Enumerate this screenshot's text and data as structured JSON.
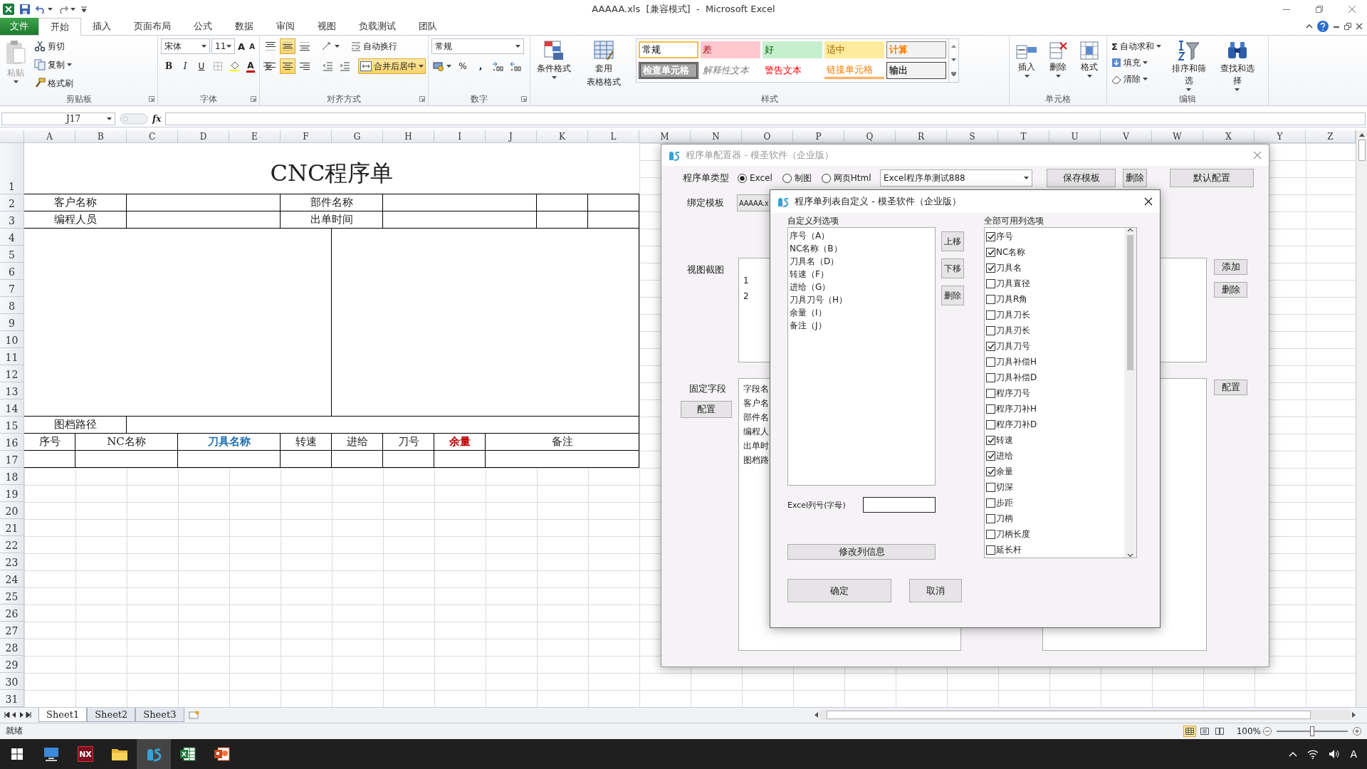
{
  "window": {
    "title": "AAAAA.xls  [兼容模式]  -  Microsoft Excel"
  },
  "ribbon_tabs": [
    {
      "label": "文件",
      "kind": "file",
      "selected": false
    },
    {
      "label": "开始",
      "kind": "tab",
      "selected": true
    },
    {
      "label": "插入",
      "kind": "tab",
      "selected": false
    },
    {
      "label": "页面布局",
      "kind": "tab",
      "selected": false
    },
    {
      "label": "公式",
      "kind": "tab",
      "selected": false
    },
    {
      "label": "数据",
      "kind": "tab",
      "selected": false
    },
    {
      "label": "审阅",
      "kind": "tab",
      "selected": false
    },
    {
      "label": "视图",
      "kind": "tab",
      "selected": false
    },
    {
      "label": "负载测试",
      "kind": "tab",
      "selected": false
    },
    {
      "label": "团队",
      "kind": "tab",
      "selected": false
    }
  ],
  "clipboard": {
    "label": "剪贴板",
    "paste": {
      "label": "粘贴",
      "disabled": true
    },
    "actions": [
      {
        "kind": "cut",
        "label": "剪切"
      },
      {
        "kind": "copy",
        "label": "复制"
      },
      {
        "kind": "painter",
        "label": "格式刷"
      }
    ]
  },
  "font": {
    "label": "字体",
    "family": "宋体",
    "size": "11",
    "grow": "A",
    "shrink": "A",
    "bold": "B",
    "italic": "I",
    "underline": "U",
    "color_letter": "A"
  },
  "alignment": {
    "label": "对齐方式",
    "vertical": [
      {
        "kind": "top",
        "selected": false
      },
      {
        "kind": "middle",
        "selected": true
      },
      {
        "kind": "bottom",
        "selected": false
      }
    ],
    "horizontal": [
      {
        "kind": "left",
        "selected": false
      },
      {
        "kind": "center",
        "selected": true
      },
      {
        "kind": "right",
        "selected": false
      }
    ],
    "wrap": "自动换行",
    "merge": {
      "label": "合并后居中",
      "selected": true
    }
  },
  "number": {
    "label": "数字",
    "format": "常规",
    "percent": "%",
    "comma": ","
  },
  "styles": {
    "label": "样式",
    "conditional": "条件格式",
    "table_format": [
      "套用",
      "表格格式"
    ],
    "gallery": [
      {
        "label": "常规",
        "kind": "normal"
      },
      {
        "label": "差",
        "kind": "bad"
      },
      {
        "label": "好",
        "kind": "good"
      },
      {
        "label": "适中",
        "kind": "neutral"
      },
      {
        "label": "计算",
        "kind": "calculation"
      },
      {
        "label": "检查单元格",
        "kind": "check"
      },
      {
        "label": "解释性文本",
        "kind": "explanatory"
      },
      {
        "label": "警告文本",
        "kind": "warning"
      },
      {
        "label": "链接单元格",
        "kind": "linked"
      },
      {
        "label": "输出",
        "kind": "output"
      }
    ]
  },
  "cells": {
    "label": "单元格",
    "commands": [
      {
        "kind": "insert",
        "label": "插入"
      },
      {
        "kind": "delete",
        "label": "删除"
      },
      {
        "kind": "format",
        "label": "格式"
      }
    ]
  },
  "editing": {
    "label": "编辑",
    "sum_sign": "Σ",
    "small": [
      {
        "kind": "sum",
        "label": "自动求和"
      },
      {
        "kind": "fill",
        "label": "填充"
      },
      {
        "kind": "clear",
        "label": "清除"
      }
    ],
    "large": [
      {
        "kind": "sort",
        "label": "排序和筛选"
      },
      {
        "kind": "find",
        "label": "查找和选择"
      }
    ]
  },
  "formula_bar": {
    "name_box": "J17",
    "fx": "fx"
  },
  "sheet": {
    "columns": [
      "A",
      "B",
      "C",
      "D",
      "E",
      "F",
      "G",
      "H",
      "I",
      "J",
      "K",
      "L",
      "M",
      "N",
      "O",
      "P",
      "Q",
      "R",
      "S",
      "T",
      "U",
      "V",
      "W",
      "X",
      "Y",
      "Z"
    ],
    "rows": [
      "1",
      "2",
      "3",
      "4",
      "5",
      "6",
      "7",
      "8",
      "9",
      "10",
      "11",
      "12",
      "13",
      "14",
      "15",
      "16",
      "17",
      "18",
      "19",
      "20",
      "21",
      "22",
      "23",
      "24",
      "25",
      "26",
      "27",
      "28",
      "29",
      "30",
      "31"
    ],
    "cells": [
      {
        "kind": "title",
        "text": "CNC程序单"
      },
      {
        "kind": "label",
        "text": "客户名称"
      },
      {
        "kind": "blank"
      },
      {
        "kind": "label",
        "text": "部件名称"
      },
      {
        "kind": "blank"
      },
      {
        "kind": "blank"
      },
      {
        "kind": "blank"
      },
      {
        "kind": "label",
        "text": "编程人员"
      },
      {
        "kind": "blank"
      },
      {
        "kind": "label",
        "text": "出单时间"
      },
      {
        "kind": "blank"
      },
      {
        "kind": "blank"
      },
      {
        "kind": "blank"
      },
      {
        "kind": "blank"
      },
      {
        "kind": "blank"
      },
      {
        "kind": "label",
        "text": "图档路径"
      },
      {
        "kind": "blank"
      },
      {
        "kind": "label",
        "text": "序号"
      },
      {
        "kind": "label",
        "text": "NC名称"
      },
      {
        "kind": "label",
        "text": "刀具名称",
        "color": "#1f6fb0"
      },
      {
        "kind": "label",
        "text": "转速"
      },
      {
        "kind": "label",
        "text": "进给"
      },
      {
        "kind": "label",
        "text": "刀号"
      },
      {
        "kind": "label",
        "text": "余量",
        "color": "#c00000"
      },
      {
        "kind": "label",
        "text": "备注"
      },
      {
        "kind": "blank"
      },
      {
        "kind": "blank"
      },
      {
        "kind": "blank"
      },
      {
        "kind": "blank"
      },
      {
        "kind": "blank"
      },
      {
        "kind": "blank"
      },
      {
        "kind": "blank"
      },
      {
        "kind": "blank"
      }
    ]
  },
  "sheet_tabs": [
    {
      "label": "Sheet1",
      "selected": true
    },
    {
      "label": "Sheet2",
      "selected": false
    },
    {
      "label": "Sheet3",
      "selected": false
    }
  ],
  "status_bar": {
    "text": "就绪",
    "zoom": "100%",
    "level": 0.5
  },
  "config_dialog": {
    "title": "程序单配置器 - 模圣软件（企业版）",
    "type_label": "程序单类型",
    "types": [
      {
        "label": "Excel",
        "selected": true
      },
      {
        "label": "制图",
        "selected": false
      },
      {
        "label": "网页Html",
        "selected": false
      }
    ],
    "template_select": "Excel程序单测试888",
    "buttons": [
      "保存模板",
      "删除",
      "默认配置"
    ],
    "bind_label": "绑定模板",
    "bind_value": "AAAAA.x",
    "view_label": "视图截图",
    "view_rows": [
      "1",
      "2"
    ],
    "view_buttons": [
      "添加",
      "删除"
    ],
    "fixed_label": "固定字段",
    "fixed_button": "配置",
    "fixed_rows": [
      "字段名",
      "客户名",
      "部件名",
      "编程人",
      "出单时",
      "图档路"
    ],
    "right_button": "配置"
  },
  "column_dialog": {
    "title": "程序单列表自定义 - 模圣软件（企业版）",
    "custom_heading": "自定义列选项",
    "custom_items": [
      "序号（A）",
      "NC名称（B）",
      "刀具名（D）",
      "转速（F）",
      "进给（G）",
      "刀具刀号（H）",
      "余量（I）",
      "备注（J）"
    ],
    "move_buttons": [
      "上移",
      "下移",
      "删除"
    ],
    "letter_label": "Excel列号(字母)",
    "modify_button": "修改列信息",
    "ok": "确定",
    "cancel": "取消",
    "all_heading": "全部可用列选项",
    "all_items": [
      {
        "label": "序号",
        "checked": true
      },
      {
        "label": "NC名称",
        "checked": true
      },
      {
        "label": "刀具名",
        "checked": true
      },
      {
        "label": "刀具直径",
        "checked": false
      },
      {
        "label": "刀具R角",
        "checked": false
      },
      {
        "label": "刀具刀长",
        "checked": false
      },
      {
        "label": "刀具刃长",
        "checked": false
      },
      {
        "label": "刀具刀号",
        "checked": true
      },
      {
        "label": "刀具补偿H",
        "checked": false
      },
      {
        "label": "刀具补偿D",
        "checked": false
      },
      {
        "label": "程序刀号",
        "checked": false
      },
      {
        "label": "程序刀补H",
        "checked": false
      },
      {
        "label": "程序刀补D",
        "checked": false
      },
      {
        "label": "转速",
        "checked": true
      },
      {
        "label": "进给",
        "checked": true
      },
      {
        "label": "余量",
        "checked": true
      },
      {
        "label": "切深",
        "checked": false
      },
      {
        "label": "步距",
        "checked": false
      },
      {
        "label": "刀柄",
        "checked": false
      },
      {
        "label": "刀柄长度",
        "checked": false
      },
      {
        "label": "延长杆",
        "checked": false
      }
    ]
  },
  "taskbar": {
    "apps": [
      {
        "kind": "monitor",
        "selected": false
      },
      {
        "kind": "nx",
        "label": "NX",
        "selected": false
      },
      {
        "kind": "folder",
        "selected": false
      },
      {
        "kind": "moshen",
        "selected": true
      },
      {
        "kind": "excel",
        "selected": false
      },
      {
        "kind": "powerpoint",
        "selected": false
      }
    ],
    "ime": "A"
  }
}
